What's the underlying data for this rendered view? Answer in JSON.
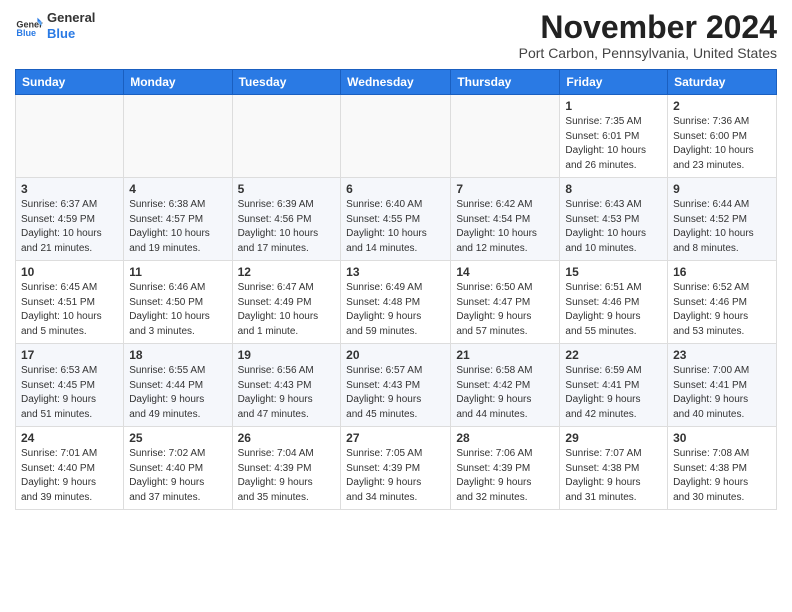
{
  "header": {
    "logo": {
      "general": "General",
      "blue": "Blue"
    },
    "title": "November 2024",
    "subtitle": "Port Carbon, Pennsylvania, United States"
  },
  "weekdays": [
    "Sunday",
    "Monday",
    "Tuesday",
    "Wednesday",
    "Thursday",
    "Friday",
    "Saturday"
  ],
  "weeks": [
    [
      {
        "day": "",
        "info": ""
      },
      {
        "day": "",
        "info": ""
      },
      {
        "day": "",
        "info": ""
      },
      {
        "day": "",
        "info": ""
      },
      {
        "day": "",
        "info": ""
      },
      {
        "day": "1",
        "info": "Sunrise: 7:35 AM\nSunset: 6:01 PM\nDaylight: 10 hours\nand 26 minutes."
      },
      {
        "day": "2",
        "info": "Sunrise: 7:36 AM\nSunset: 6:00 PM\nDaylight: 10 hours\nand 23 minutes."
      }
    ],
    [
      {
        "day": "3",
        "info": "Sunrise: 6:37 AM\nSunset: 4:59 PM\nDaylight: 10 hours\nand 21 minutes."
      },
      {
        "day": "4",
        "info": "Sunrise: 6:38 AM\nSunset: 4:57 PM\nDaylight: 10 hours\nand 19 minutes."
      },
      {
        "day": "5",
        "info": "Sunrise: 6:39 AM\nSunset: 4:56 PM\nDaylight: 10 hours\nand 17 minutes."
      },
      {
        "day": "6",
        "info": "Sunrise: 6:40 AM\nSunset: 4:55 PM\nDaylight: 10 hours\nand 14 minutes."
      },
      {
        "day": "7",
        "info": "Sunrise: 6:42 AM\nSunset: 4:54 PM\nDaylight: 10 hours\nand 12 minutes."
      },
      {
        "day": "8",
        "info": "Sunrise: 6:43 AM\nSunset: 4:53 PM\nDaylight: 10 hours\nand 10 minutes."
      },
      {
        "day": "9",
        "info": "Sunrise: 6:44 AM\nSunset: 4:52 PM\nDaylight: 10 hours\nand 8 minutes."
      }
    ],
    [
      {
        "day": "10",
        "info": "Sunrise: 6:45 AM\nSunset: 4:51 PM\nDaylight: 10 hours\nand 5 minutes."
      },
      {
        "day": "11",
        "info": "Sunrise: 6:46 AM\nSunset: 4:50 PM\nDaylight: 10 hours\nand 3 minutes."
      },
      {
        "day": "12",
        "info": "Sunrise: 6:47 AM\nSunset: 4:49 PM\nDaylight: 10 hours\nand 1 minute."
      },
      {
        "day": "13",
        "info": "Sunrise: 6:49 AM\nSunset: 4:48 PM\nDaylight: 9 hours\nand 59 minutes."
      },
      {
        "day": "14",
        "info": "Sunrise: 6:50 AM\nSunset: 4:47 PM\nDaylight: 9 hours\nand 57 minutes."
      },
      {
        "day": "15",
        "info": "Sunrise: 6:51 AM\nSunset: 4:46 PM\nDaylight: 9 hours\nand 55 minutes."
      },
      {
        "day": "16",
        "info": "Sunrise: 6:52 AM\nSunset: 4:46 PM\nDaylight: 9 hours\nand 53 minutes."
      }
    ],
    [
      {
        "day": "17",
        "info": "Sunrise: 6:53 AM\nSunset: 4:45 PM\nDaylight: 9 hours\nand 51 minutes."
      },
      {
        "day": "18",
        "info": "Sunrise: 6:55 AM\nSunset: 4:44 PM\nDaylight: 9 hours\nand 49 minutes."
      },
      {
        "day": "19",
        "info": "Sunrise: 6:56 AM\nSunset: 4:43 PM\nDaylight: 9 hours\nand 47 minutes."
      },
      {
        "day": "20",
        "info": "Sunrise: 6:57 AM\nSunset: 4:43 PM\nDaylight: 9 hours\nand 45 minutes."
      },
      {
        "day": "21",
        "info": "Sunrise: 6:58 AM\nSunset: 4:42 PM\nDaylight: 9 hours\nand 44 minutes."
      },
      {
        "day": "22",
        "info": "Sunrise: 6:59 AM\nSunset: 4:41 PM\nDaylight: 9 hours\nand 42 minutes."
      },
      {
        "day": "23",
        "info": "Sunrise: 7:00 AM\nSunset: 4:41 PM\nDaylight: 9 hours\nand 40 minutes."
      }
    ],
    [
      {
        "day": "24",
        "info": "Sunrise: 7:01 AM\nSunset: 4:40 PM\nDaylight: 9 hours\nand 39 minutes."
      },
      {
        "day": "25",
        "info": "Sunrise: 7:02 AM\nSunset: 4:40 PM\nDaylight: 9 hours\nand 37 minutes."
      },
      {
        "day": "26",
        "info": "Sunrise: 7:04 AM\nSunset: 4:39 PM\nDaylight: 9 hours\nand 35 minutes."
      },
      {
        "day": "27",
        "info": "Sunrise: 7:05 AM\nSunset: 4:39 PM\nDaylight: 9 hours\nand 34 minutes."
      },
      {
        "day": "28",
        "info": "Sunrise: 7:06 AM\nSunset: 4:39 PM\nDaylight: 9 hours\nand 32 minutes."
      },
      {
        "day": "29",
        "info": "Sunrise: 7:07 AM\nSunset: 4:38 PM\nDaylight: 9 hours\nand 31 minutes."
      },
      {
        "day": "30",
        "info": "Sunrise: 7:08 AM\nSunset: 4:38 PM\nDaylight: 9 hours\nand 30 minutes."
      }
    ]
  ]
}
